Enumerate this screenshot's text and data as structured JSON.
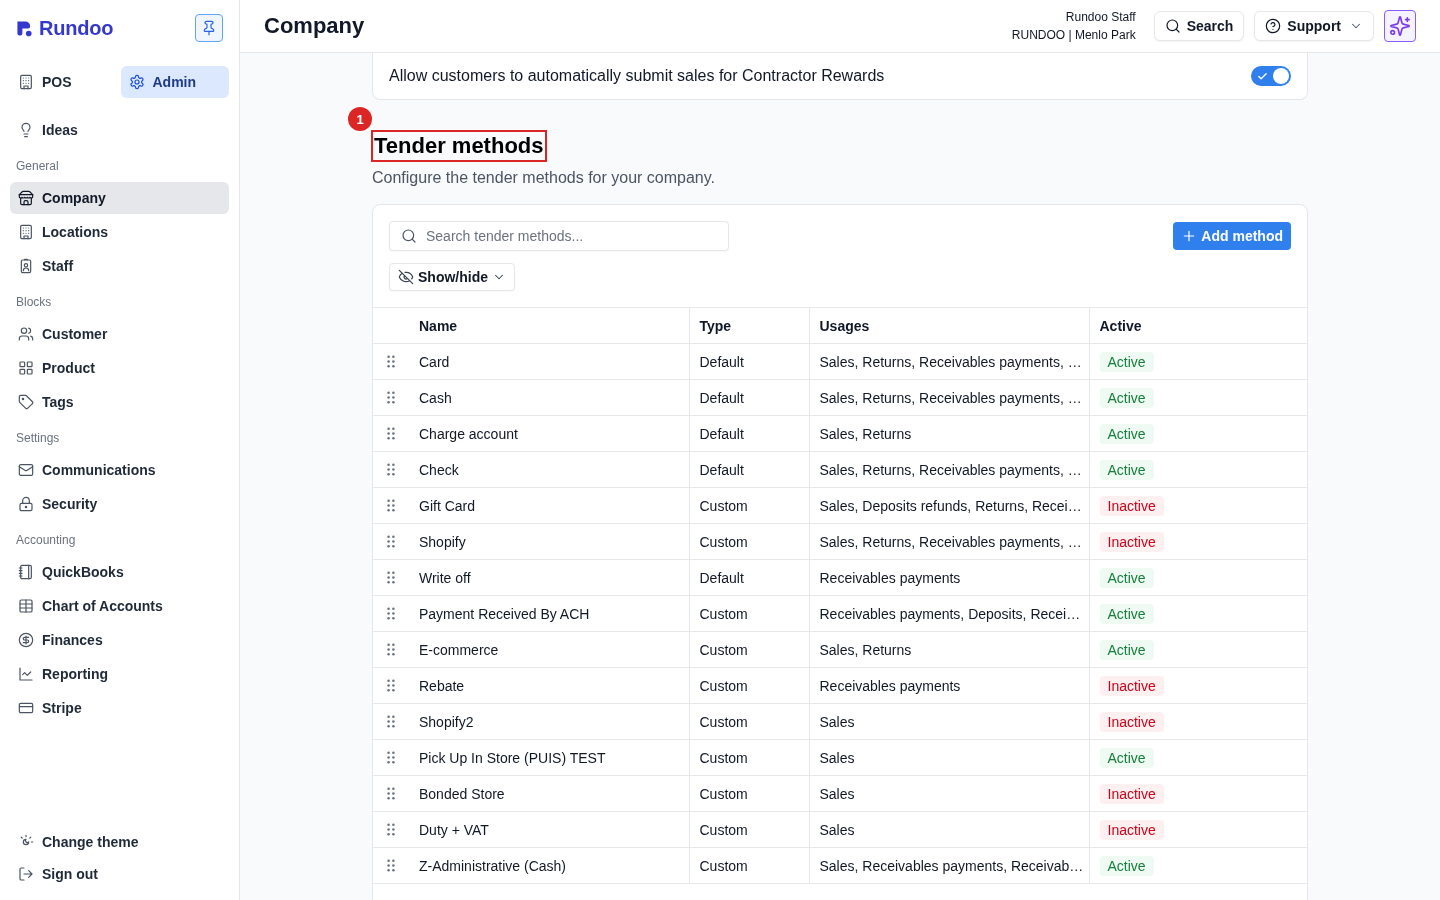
{
  "sidebar": {
    "logo": "Rundoo",
    "top_tabs": [
      {
        "label": "POS",
        "selected": false
      },
      {
        "label": "Admin",
        "selected": true
      }
    ],
    "sections": [
      {
        "items": [
          {
            "label": "Ideas",
            "selected": false
          }
        ]
      },
      {
        "heading": "General",
        "items": [
          {
            "label": "Company",
            "selected": true
          },
          {
            "label": "Locations",
            "selected": false
          },
          {
            "label": "Staff",
            "selected": false
          }
        ]
      },
      {
        "heading": "Blocks",
        "items": [
          {
            "label": "Customer",
            "selected": false
          },
          {
            "label": "Product",
            "selected": false
          },
          {
            "label": "Tags",
            "selected": false
          }
        ]
      },
      {
        "heading": "Settings",
        "items": [
          {
            "label": "Communications",
            "selected": false
          },
          {
            "label": "Security",
            "selected": false
          }
        ]
      },
      {
        "heading": "Accounting",
        "items": [
          {
            "label": "QuickBooks",
            "selected": false
          },
          {
            "label": "Chart of Accounts",
            "selected": false
          },
          {
            "label": "Finances",
            "selected": false
          },
          {
            "label": "Reporting",
            "selected": false
          },
          {
            "label": "Stripe",
            "selected": false
          }
        ]
      }
    ],
    "footer_items": [
      {
        "label": "Change theme"
      },
      {
        "label": "Sign out"
      }
    ]
  },
  "header": {
    "title": "Company",
    "user_name": "Rundoo Staff",
    "user_location": "RUNDOO | Menlo Park",
    "search_button": "Search",
    "support_button": "Support"
  },
  "contractor_rewards": {
    "label": "Allow customers to automatically submit sales for Contractor Rewards",
    "on": true
  },
  "tender_methods": {
    "annotation": {
      "number": "1"
    },
    "title": "Tender methods",
    "description": "Configure the tender methods for your company.",
    "search": {
      "placeholder": "Search tender methods..."
    },
    "add_button": "Add method",
    "show_hide_button": "Show/hide",
    "table": {
      "columns": [
        "Name",
        "Type",
        "Usages",
        "Active"
      ],
      "rows": [
        {
          "name": "Card",
          "type": "Default",
          "usages": "Sales, Returns, Receivables payments, …",
          "status": "Active",
          "active": true
        },
        {
          "name": "Cash",
          "type": "Default",
          "usages": "Sales, Returns, Receivables payments, …",
          "status": "Active",
          "active": true
        },
        {
          "name": "Charge account",
          "type": "Default",
          "usages": "Sales, Returns",
          "status": "Active",
          "active": true
        },
        {
          "name": "Check",
          "type": "Default",
          "usages": "Sales, Returns, Receivables payments, …",
          "status": "Active",
          "active": true
        },
        {
          "name": "Gift Card",
          "type": "Custom",
          "usages": "Sales, Deposits refunds, Returns, Recei…",
          "status": "Inactive",
          "active": false
        },
        {
          "name": "Shopify",
          "type": "Custom",
          "usages": "Sales, Returns, Receivables payments, …",
          "status": "Inactive",
          "active": false
        },
        {
          "name": "Write off",
          "type": "Default",
          "usages": "Receivables payments",
          "status": "Active",
          "active": true
        },
        {
          "name": "Payment Received By ACH",
          "type": "Custom",
          "usages": "Receivables payments, Deposits, Recei…",
          "status": "Active",
          "active": true
        },
        {
          "name": "E-commerce",
          "type": "Custom",
          "usages": "Sales, Returns",
          "status": "Active",
          "active": true
        },
        {
          "name": "Rebate",
          "type": "Custom",
          "usages": "Receivables payments",
          "status": "Inactive",
          "active": false
        },
        {
          "name": "Shopify2",
          "type": "Custom",
          "usages": "Sales",
          "status": "Inactive",
          "active": false
        },
        {
          "name": "Pick Up In Store (PUIS) TEST",
          "type": "Custom",
          "usages": "Sales",
          "status": "Active",
          "active": true
        },
        {
          "name": "Bonded Store",
          "type": "Custom",
          "usages": "Sales",
          "status": "Inactive",
          "active": false
        },
        {
          "name": "Duty + VAT",
          "type": "Custom",
          "usages": "Sales",
          "status": "Inactive",
          "active": false
        },
        {
          "name": "Z-Administrative (Cash)",
          "type": "Custom",
          "usages": "Sales, Receivables payments, Receivab…",
          "status": "Active",
          "active": true
        }
      ]
    }
  }
}
